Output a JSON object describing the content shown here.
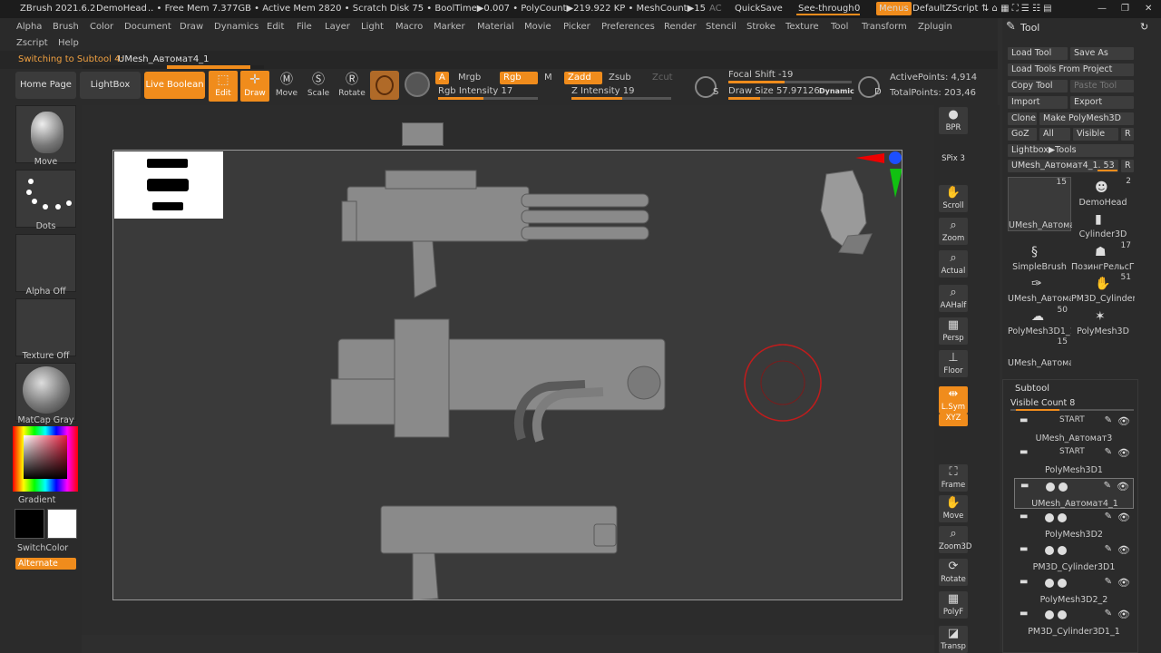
{
  "titlebar": {
    "app": "ZBrush 2021.6.2",
    "doc": "DemoHead",
    "stats": ".. • Free Mem 7.377GB • Active Mem 2820 • Scratch Disk 75 • BoolTime▶0.007 • PolyCount▶219.922 KP • MeshCount▶15",
    "ac": "AC",
    "quicksave": "QuickSave",
    "seethrough": "See-through",
    "seethrough_val": "0",
    "menus": "Menus",
    "script": "DefaultZScript"
  },
  "menu": [
    "Alpha",
    "Brush",
    "Color",
    "Document",
    "Draw",
    "Dynamics",
    "Edit",
    "File",
    "Layer",
    "Light",
    "Macro",
    "Marker",
    "Material",
    "Movie",
    "Picker",
    "Preferences",
    "Render",
    "Stencil",
    "Stroke",
    "Texture",
    "Tool",
    "Transform",
    "Zplugin"
  ],
  "menu2": [
    "Zscript",
    "Help"
  ],
  "status": {
    "label": "Switching to Subtool 4:",
    "value": "UMesh_Автомат4_1"
  },
  "toolbar": {
    "home": "Home Page",
    "lightbox": "LightBox",
    "liveboolean": "Live Boolean",
    "edit": "Edit",
    "draw": "Draw",
    "move": "Move",
    "scale": "Scale",
    "rotate": "Rotate",
    "a": "A",
    "mrgb": "Mrgb",
    "rgb": "Rgb",
    "m": "M",
    "zadd": "Zadd",
    "zsub": "Zsub",
    "zcut": "Zcut",
    "rgb_intensity": "Rgb Intensity 17",
    "z_intensity": "Z Intensity 19",
    "focal": "Focal Shift -19",
    "drawsize": "Draw Size 57.97126",
    "dynamic": "Dynamic",
    "active_points": "ActivePoints: 4,914",
    "total_points": "TotalPoints: 203,46",
    "s": "S",
    "d": "D"
  },
  "leftshelf": {
    "brush": "Move",
    "stroke": "Dots",
    "alpha": "Alpha Off",
    "texture": "Texture Off",
    "material": "MatCap Gray",
    "gradient": "Gradient",
    "switchcolor": "SwitchColor",
    "alternate": "Alternate"
  },
  "rightshelf": [
    "BPR",
    "SPix 3",
    "Scroll",
    "Zoom",
    "Actual",
    "AAHalf",
    "Persp",
    "Floor",
    "L.Sym",
    "XYZ",
    "Frame",
    "Move",
    "Zoom3D",
    "Rotate",
    "PolyF",
    "Transp"
  ],
  "toolpanel": {
    "title": "Tool",
    "load_tool": "Load Tool",
    "save_as": "Save As",
    "load_project": "Load Tools From Project",
    "copy_tool": "Copy Tool",
    "paste_tool": "Paste Tool",
    "import": "Import",
    "export": "Export",
    "clone": "Clone",
    "make_polymesh": "Make PolyMesh3D",
    "goz": "GoZ",
    "all": "All",
    "visible": "Visible",
    "r": "R",
    "lightbox_tools": "Lightbox▶Tools",
    "current_tool": "UMesh_Автомат4_1. 53",
    "thumbs": [
      {
        "label": "UMesh_Автома",
        "num": "15"
      },
      {
        "label": "DemoHead",
        "num": "2"
      },
      {
        "label": "Cylinder3D",
        "num": ""
      },
      {
        "label": "SimpleBrush",
        "num": ""
      },
      {
        "label": "ПозингРельсГа",
        "num": "17"
      },
      {
        "label": "UMesh_Автома",
        "num": ""
      },
      {
        "label": "PM3D_Cylinder:",
        "num": "51"
      },
      {
        "label": "PolyMesh3D1_1",
        "num": "50"
      },
      {
        "label": "PolyMesh3D",
        "num": ""
      },
      {
        "label": "UMesh_Автома",
        "num": "15"
      }
    ],
    "subtool_title": "Subtool",
    "visible_count": "Visible Count 8",
    "subtools": [
      {
        "name": "UMesh_Автомат3",
        "tag": "START"
      },
      {
        "name": "PolyMesh3D1",
        "tag": "START"
      },
      {
        "name": "UMesh_Автомат4_1",
        "tag": ""
      },
      {
        "name": "PolyMesh3D2",
        "tag": ""
      },
      {
        "name": "PM3D_Cylinder3D1",
        "tag": ""
      },
      {
        "name": "PolyMesh3D2_2",
        "tag": ""
      },
      {
        "name": "PM3D_Cylinder3D1_1",
        "tag": ""
      }
    ]
  },
  "colors": {
    "accent": "#f08c1c",
    "panel": "#2b2b2b",
    "canvas": "#3a3a3a"
  }
}
